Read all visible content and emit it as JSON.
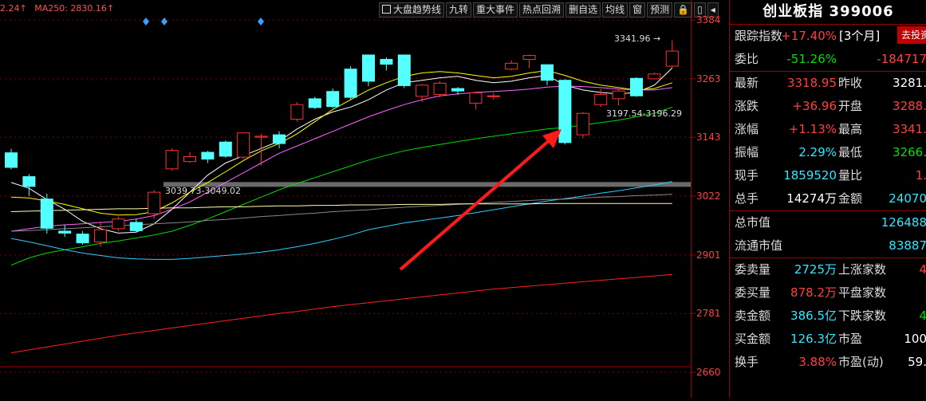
{
  "legend": {
    "ma_left": "2.24↑",
    "ma250": "MA250: 2830.16↑"
  },
  "toolbar": [
    "大盘趋势线",
    "九转",
    "重大事件",
    "热点回溯",
    "删自选",
    "均线",
    "窗",
    "预测",
    "🔒",
    "▯",
    "◂"
  ],
  "panel": {
    "title": "创业板指 399006",
    "rows": [
      {
        "label": "跟踪指数",
        "value": "+17.40%",
        "extra": "[3个月]",
        "color": "red"
      },
      {
        "label": "委比",
        "value": "-51.26%",
        "value2": "-184717",
        "color": "green"
      },
      {
        "label": "最新",
        "value": "3318.95",
        "label2": "昨收",
        "value2": "3281.",
        "color": "red",
        "color2": "white"
      },
      {
        "label": "涨跌",
        "value": "+36.96",
        "label2": "开盘",
        "value2": "3288.",
        "color": "red",
        "color2": "red"
      },
      {
        "label": "涨幅",
        "value": "+1.13%",
        "label2": "最高",
        "value2": "3341.",
        "color": "red",
        "color2": "red"
      },
      {
        "label": "振幅",
        "value": "2.29%",
        "label2": "最低",
        "value2": "3266.",
        "color": "cyan",
        "color2": "green"
      },
      {
        "label": "现手",
        "value": "1859520",
        "label2": "量比",
        "value2": "1.",
        "color": "cyan",
        "color2": "red"
      },
      {
        "label": "总手",
        "value": "14274万",
        "label2": "金额",
        "value2": "24070",
        "color": "white",
        "color2": "cyan"
      },
      {
        "label": "总市值",
        "value2": "126488",
        "color2": "cyan"
      },
      {
        "label": "流通市值",
        "value2": "83887",
        "color2": "cyan"
      },
      {
        "label": "委卖量",
        "value": "2725万",
        "label2": "上涨家数",
        "value2": "4",
        "color": "cyan",
        "color2": "red"
      },
      {
        "label": "委买量",
        "value": "878.2万",
        "label2": "平盘家数",
        "value2": "",
        "color": "red",
        "color2": "white"
      },
      {
        "label": "卖金额",
        "value": "386.5亿",
        "label2": "下跌家数",
        "value2": "4",
        "color": "cyan",
        "color2": "green"
      },
      {
        "label": "买金额",
        "value": "126.3亿",
        "label2": "市盈",
        "value2": "100",
        "color": "cyan",
        "color2": "white"
      },
      {
        "label": "换手",
        "value": "3.88%",
        "label2": "市盈(动)",
        "value2": "59.",
        "color": "red",
        "color2": "white"
      }
    ],
    "invest_button": "去投资"
  },
  "chart_data": {
    "type": "candlestick",
    "y_ticks": [
      3384,
      3263,
      3143,
      3022,
      2901,
      2781,
      2660
    ],
    "ylim": [
      2650,
      3400
    ],
    "annotations": {
      "high_label": "3341.96",
      "range_label_1": "3039.73-3049.02",
      "range_label_2": "3197.54-3196.29"
    },
    "candles": [
      [
        3111,
        3081,
        3119,
        3077
      ],
      [
        3062,
        3042,
        3067,
        3022
      ],
      [
        3016,
        2956,
        3027,
        2945
      ],
      [
        2950,
        2946,
        2963,
        2938
      ],
      [
        2944,
        2926,
        2950,
        2922
      ],
      [
        2928,
        2953,
        2970,
        2918
      ],
      [
        2955,
        2975,
        2980,
        2950
      ],
      [
        2968,
        2951,
        2975,
        2948
      ],
      [
        2986,
        3030,
        3035,
        2975
      ],
      [
        3078,
        3116,
        3120,
        3074
      ],
      [
        3093,
        3103,
        3112,
        3090
      ],
      [
        3112,
        3098,
        3115,
        3090
      ],
      [
        3133,
        3104,
        3136,
        3101
      ],
      [
        3102,
        3152,
        3153,
        3098
      ],
      [
        3143,
        3145,
        3150,
        3085
      ],
      [
        3148,
        3130,
        3155,
        3120
      ],
      [
        3180,
        3210,
        3215,
        3175
      ],
      [
        3222,
        3204,
        3226,
        3201
      ],
      [
        3237,
        3206,
        3243,
        3203
      ],
      [
        3283,
        3225,
        3289,
        3221
      ],
      [
        3312,
        3258,
        3313,
        3248
      ],
      [
        3303,
        3293,
        3307,
        3280
      ],
      [
        3312,
        3249,
        3313,
        3244
      ],
      [
        3227,
        3250,
        3252,
        3215
      ],
      [
        3231,
        3254,
        3258,
        3225
      ],
      [
        3243,
        3238,
        3246,
        3230
      ],
      [
        3213,
        3234,
        3237,
        3200
      ],
      [
        3227,
        3228,
        3234,
        3220
      ],
      [
        3283,
        3295,
        3301,
        3280
      ],
      [
        3303,
        3311,
        3313,
        3285
      ],
      [
        3292,
        3260,
        3293,
        3250
      ],
      [
        3260,
        3132,
        3262,
        3128
      ],
      [
        3148,
        3192,
        3195,
        3141
      ],
      [
        3210,
        3231,
        3242,
        3205
      ],
      [
        3222,
        3238,
        3242,
        3208
      ],
      [
        3264,
        3228,
        3266,
        3226
      ],
      [
        3263,
        3273,
        3276,
        3262
      ],
      [
        3289,
        3320,
        3342,
        3285
      ]
    ],
    "moving_averages": [
      {
        "color": "#ffffff",
        "y": [
          3050,
          3038,
          3015,
          2995,
          2970,
          2955,
          2946,
          2948,
          2965,
          2995,
          3030,
          3065,
          3090,
          3105,
          3120,
          3135,
          3160,
          3180,
          3195,
          3205,
          3220,
          3240,
          3255,
          3260,
          3265,
          3268,
          3260,
          3255,
          3258,
          3265,
          3270,
          3250,
          3240,
          3235,
          3232,
          3235,
          3250,
          3285
        ]
      },
      {
        "color": "#ffff00",
        "y": [
          3020,
          3018,
          3012,
          3005,
          2996,
          2987,
          2983,
          2984,
          2990,
          3008,
          3030,
          3050,
          3072,
          3095,
          3115,
          3130,
          3150,
          3175,
          3200,
          3220,
          3240,
          3255,
          3268,
          3275,
          3278,
          3275,
          3270,
          3265,
          3268,
          3275,
          3280,
          3270,
          3258,
          3250,
          3245,
          3240,
          3243,
          3255
        ]
      },
      {
        "color": "#ff66ff",
        "y": [
          2950,
          2955,
          2960,
          2963,
          2965,
          2968,
          2970,
          2975,
          2982,
          2995,
          3010,
          3030,
          3050,
          3070,
          3090,
          3110,
          3125,
          3140,
          3155,
          3170,
          3185,
          3198,
          3210,
          3220,
          3228,
          3232,
          3235,
          3237,
          3239,
          3242,
          3246,
          3248,
          3247,
          3245,
          3242,
          3240,
          3240,
          3245
        ]
      },
      {
        "color": "#00dd00",
        "y": [
          2880,
          2895,
          2905,
          2912,
          2918,
          2925,
          2930,
          2936,
          2942,
          2950,
          2962,
          2975,
          2990,
          3005,
          3020,
          3035,
          3048,
          3060,
          3072,
          3084,
          3096,
          3106,
          3115,
          3122,
          3128,
          3134,
          3140,
          3145,
          3150,
          3155,
          3160,
          3163,
          3168,
          3173,
          3178,
          3185,
          3192,
          3205
        ]
      },
      {
        "color": "#33ccff",
        "y": [
          2935,
          2928,
          2920,
          2912,
          2905,
          2900,
          2895,
          2893,
          2892,
          2892,
          2894,
          2897,
          2900,
          2903,
          2907,
          2912,
          2918,
          2925,
          2933,
          2942,
          2953,
          2960,
          2967,
          2972,
          2977,
          2982,
          2988,
          2994,
          3000,
          3006,
          3012,
          3017,
          3022,
          3028,
          3033,
          3039,
          3045,
          3052
        ]
      },
      {
        "color": "#888888",
        "y": [
          2950,
          2951,
          2953,
          2955,
          2957,
          2959,
          2961,
          2963,
          2965,
          2967,
          2969,
          2972,
          2974,
          2977,
          2980,
          2982,
          2985,
          2987,
          2990,
          2992,
          2994,
          2997,
          2999,
          3001,
          3003,
          3005,
          3007,
          3009,
          3011,
          3013,
          3015,
          3016,
          3018,
          3020,
          3021,
          3023,
          3024,
          3026
        ]
      },
      {
        "color": "#ffffaa",
        "y": [
          2990,
          2991,
          2992,
          2993,
          2994,
          2995,
          2996,
          2996,
          2997,
          2998,
          2998,
          2999,
          3000,
          3000,
          3001,
          3002,
          3002,
          3003,
          3003,
          3004,
          3004,
          3004,
          3005,
          3005,
          3005,
          3006,
          3006,
          3006,
          3006,
          3006,
          3007,
          3007,
          3007,
          3007,
          3007,
          3007,
          3007,
          3007
        ]
      },
      {
        "color": "#ff2020",
        "y": [
          2700,
          2706,
          2712,
          2718,
          2724,
          2730,
          2736,
          2741,
          2746,
          2751,
          2756,
          2761,
          2766,
          2771,
          2776,
          2781,
          2785,
          2790,
          2795,
          2799,
          2803,
          2807,
          2811,
          2815,
          2819,
          2823,
          2827,
          2831,
          2834,
          2837,
          2840,
          2843,
          2846,
          2849,
          2852,
          2855,
          2858,
          2861
        ]
      }
    ],
    "up_color": "#ff3030",
    "down_color": "#54ffff"
  }
}
